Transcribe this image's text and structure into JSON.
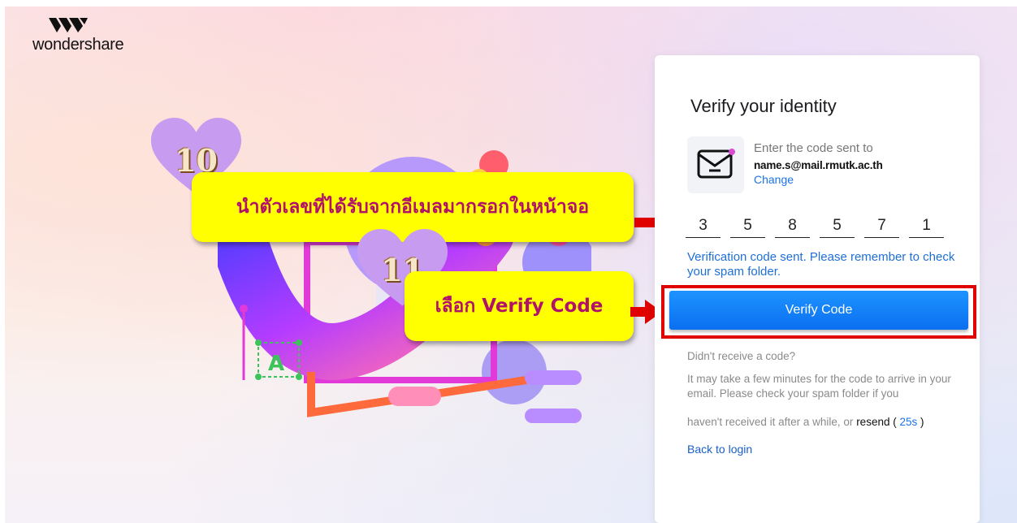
{
  "brand": {
    "name": "wondershare"
  },
  "card": {
    "title": "Verify your identity",
    "enter_code_text": "Enter the code sent to",
    "email": "name.s@mail.rmutk.ac.th",
    "change_label": "Change",
    "code_digits": [
      "3",
      "5",
      "8",
      "5",
      "7",
      "1"
    ],
    "sent_message": "Verification code sent. Please remember to check your spam folder.",
    "verify_button_label": "Verify Code",
    "didnt_receive": "Didn't receive a code?",
    "may_take": "It may take a few minutes for the code to arrive in your email. Please check your spam folder if you",
    "havent_received": "haven't received it after a while, or ",
    "resend_label": "resend",
    "timer_open": " ( ",
    "timer": "25s",
    "timer_close": " )",
    "back_to_login": "Back to login"
  },
  "annotations": {
    "step10": {
      "number": "10",
      "text": "นำตัวเลขที่ได้รับจากอีเมลมากรอกในหน้าจอ"
    },
    "step11": {
      "number": "11",
      "text": "เลือก Verify Code"
    }
  },
  "illustration_letter": "A",
  "colors": {
    "accent_blue": "#0b6ff0",
    "link_blue": "#1a73e8",
    "highlight_yellow": "#ffff00",
    "annotation_text": "#b0126a",
    "heart_purple": "#c79bf0",
    "arrow_red": "#e00000"
  }
}
